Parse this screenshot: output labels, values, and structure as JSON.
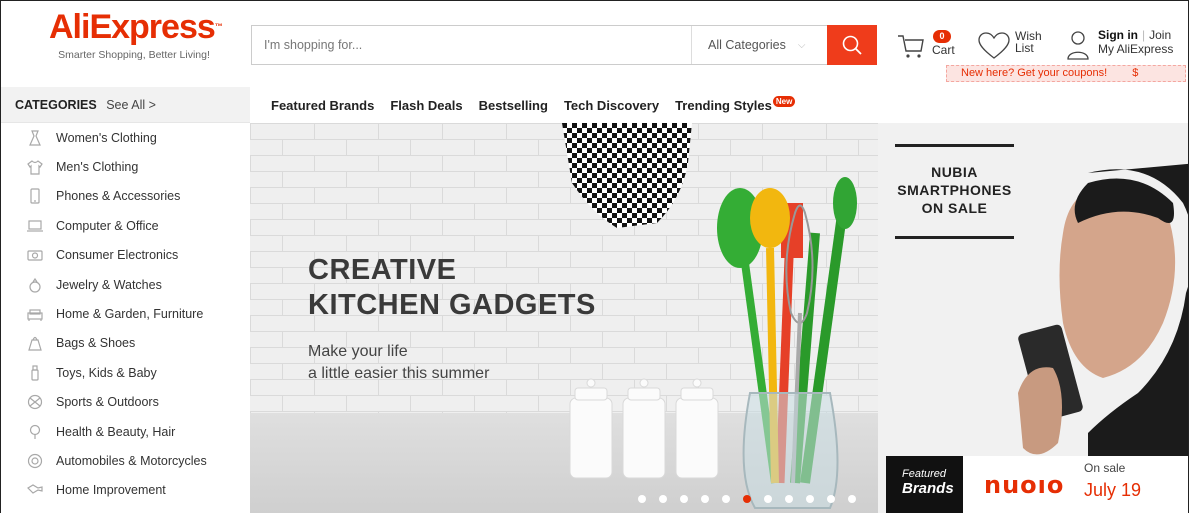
{
  "header": {
    "logo": "AliExpress",
    "tagline": "Smarter Shopping, Better Living!",
    "search_placeholder": "I'm shopping for...",
    "category_select": "All Categories",
    "cart_count": "0",
    "cart_label": "Cart",
    "wish_line1": "Wish",
    "wish_line2": "List",
    "sign_in": "Sign in",
    "join": "Join",
    "my_aliexpress": "My AliExpress",
    "coupon_text": "New here? Get your coupons!",
    "coupon_symbol": "$"
  },
  "category_bar": {
    "title": "CATEGORIES",
    "see_all": "See All >"
  },
  "top_nav": [
    {
      "label": "Featured Brands"
    },
    {
      "label": "Flash Deals"
    },
    {
      "label": "Bestselling"
    },
    {
      "label": "Tech Discovery"
    },
    {
      "label": "Trending Styles",
      "badge": "New"
    }
  ],
  "sidebar": [
    {
      "label": "Women's Clothing",
      "icon": "dress-icon"
    },
    {
      "label": "Men's Clothing",
      "icon": "shirt-icon"
    },
    {
      "label": "Phones & Accessories",
      "icon": "phone-icon"
    },
    {
      "label": "Computer & Office",
      "icon": "laptop-icon"
    },
    {
      "label": "Consumer Electronics",
      "icon": "camera-icon"
    },
    {
      "label": "Jewelry & Watches",
      "icon": "ring-icon"
    },
    {
      "label": "Home & Garden, Furniture",
      "icon": "sofa-icon"
    },
    {
      "label": "Bags & Shoes",
      "icon": "bag-icon"
    },
    {
      "label": "Toys, Kids & Baby",
      "icon": "bottle-icon"
    },
    {
      "label": "Sports & Outdoors",
      "icon": "ball-icon"
    },
    {
      "label": "Health & Beauty, Hair",
      "icon": "beauty-icon"
    },
    {
      "label": "Automobiles & Motorcycles",
      "icon": "wheel-icon"
    },
    {
      "label": "Home Improvement",
      "icon": "tool-icon"
    }
  ],
  "hero": {
    "title_line1": "CREATIVE",
    "title_line2": "KITCHEN GADGETS",
    "sub_line1": "Make your life",
    "sub_line2": "a little easier this summer",
    "slide_count": 11,
    "active_slide": 5
  },
  "promo": {
    "title_line1": "NUBIA",
    "title_line2": "SMARTPHONES",
    "title_line3": "ON SALE",
    "featured1": "Featured",
    "featured2": "Brands",
    "brand": "nuoıo",
    "on_sale": "On sale",
    "date": "July 19"
  },
  "colors": {
    "brand_red": "#e62e04",
    "search_button": "#ef3c1b"
  }
}
